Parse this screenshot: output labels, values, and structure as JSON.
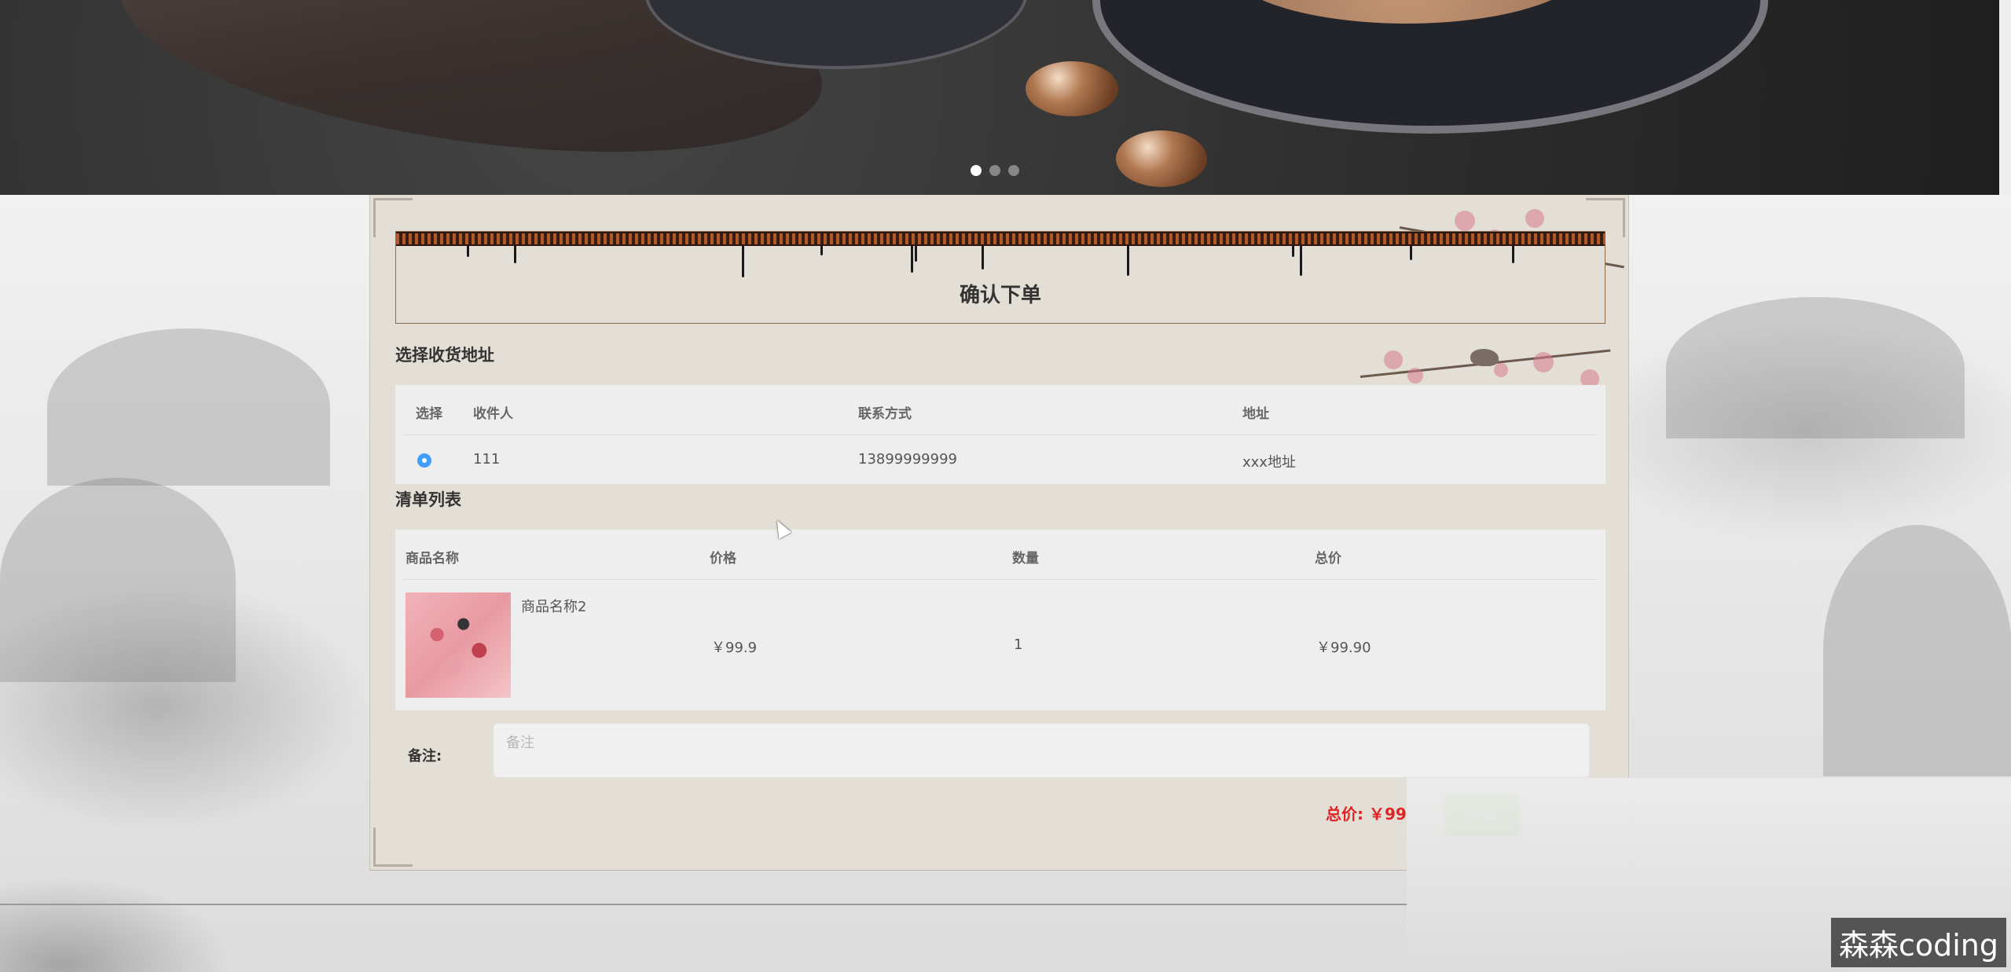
{
  "banner": {
    "dots": [
      {
        "active": true
      },
      {
        "active": false
      },
      {
        "active": false
      }
    ]
  },
  "order": {
    "title": "确认下单"
  },
  "address_section": {
    "title": "选择收货地址",
    "columns": [
      "选择",
      "收件人",
      "联系方式",
      "地址"
    ],
    "rows": [
      {
        "selected": true,
        "recipient": "111",
        "phone": "13899999999",
        "address": "xxx地址"
      }
    ]
  },
  "list_section": {
    "title": "清单列表",
    "columns": [
      "商品名称",
      "价格",
      "数量",
      "总价"
    ],
    "rows": [
      {
        "name": "商品名称2",
        "price": "￥99.9",
        "quantity": "1",
        "total": "￥99.90"
      }
    ]
  },
  "note": {
    "label": "备注:",
    "placeholder": "备注",
    "value": ""
  },
  "summary": {
    "total_label": "总价:",
    "total_value": "￥99",
    "submit_label": "下单"
  },
  "watermark": "森森coding",
  "colors": {
    "accent": "#409eff",
    "price_red": "#e02424",
    "submit_green": "#67c23a",
    "panel_bg": "#e4dfd6"
  }
}
